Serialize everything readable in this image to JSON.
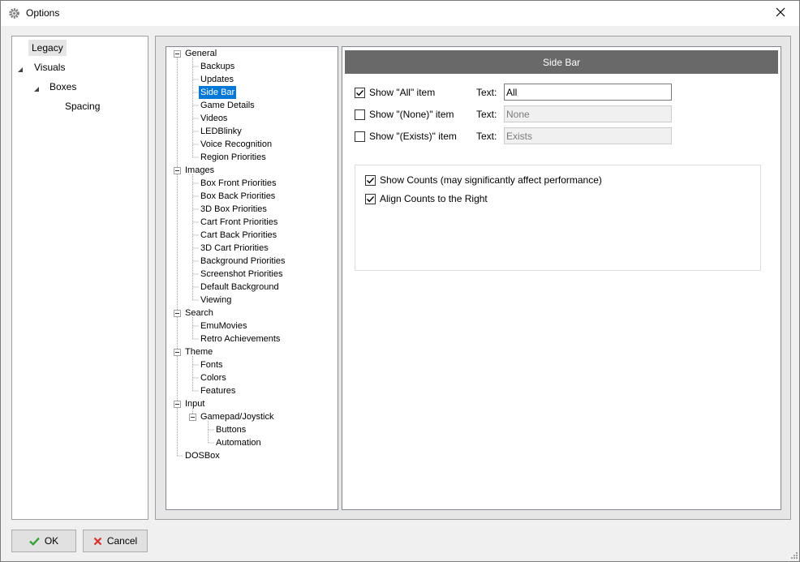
{
  "window": {
    "title": "Options"
  },
  "left_tree": {
    "items": [
      {
        "label": "Legacy",
        "selected": true
      },
      {
        "label": "Visuals",
        "expanded": true
      },
      {
        "label": "Boxes",
        "expanded": true
      },
      {
        "label": "Spacing"
      }
    ]
  },
  "categories": {
    "general": {
      "label": "General",
      "children": [
        "Backups",
        "Updates",
        "Side Bar",
        "Game Details",
        "Videos",
        "LEDBlinky",
        "Voice Recognition",
        "Region Priorities"
      ]
    },
    "images": {
      "label": "Images",
      "children": [
        "Box Front Priorities",
        "Box Back Priorities",
        "3D Box Priorities",
        "Cart Front Priorities",
        "Cart Back Priorities",
        "3D Cart Priorities",
        "Background Priorities",
        "Screenshot Priorities",
        "Default Background",
        "Viewing"
      ]
    },
    "search": {
      "label": "Search",
      "children": [
        "EmuMovies",
        "Retro Achievements"
      ]
    },
    "theme": {
      "label": "Theme",
      "children": [
        "Fonts",
        "Colors",
        "Features"
      ]
    },
    "input": {
      "label": "Input",
      "gamepad": {
        "label": "Gamepad/Joystick",
        "children": [
          "Buttons",
          "Automation"
        ]
      }
    },
    "dosbox": {
      "label": "DOSBox"
    },
    "selected": "Side Bar"
  },
  "side_bar": {
    "header": "Side Bar",
    "rows": [
      {
        "label": "Show \"All\" item",
        "checked": true,
        "text_label": "Text:",
        "text_value": "All",
        "enabled": true
      },
      {
        "label": "Show \"(None)\" item",
        "checked": false,
        "text_label": "Text:",
        "text_value": "None",
        "enabled": false
      },
      {
        "label": "Show \"(Exists)\" item",
        "checked": false,
        "text_label": "Text:",
        "text_value": "Exists",
        "enabled": false
      }
    ],
    "show_counts": {
      "label": "Show Counts (may significantly affect performance)",
      "checked": true
    },
    "align_counts": {
      "label": "Align Counts to the Right",
      "checked": true
    }
  },
  "buttons": {
    "ok": "OK",
    "cancel": "Cancel"
  },
  "colors": {
    "selection": "#0078d7",
    "header": "#696969",
    "ok_check": "#3aa03a",
    "cancel_x": "#d9302c"
  },
  "icons": {
    "app": "gear-icon",
    "close": "close-icon",
    "ok": "checkmark-icon",
    "cancel": "x-icon"
  }
}
